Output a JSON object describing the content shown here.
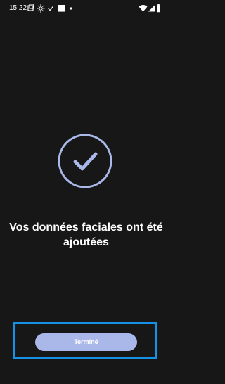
{
  "status_bar": {
    "time": "15:22",
    "icons": [
      "screenshot-icon",
      "brightness-icon",
      "check-small-icon",
      "image-icon",
      "dot-icon",
      "wifi-icon",
      "signal-icon",
      "battery-icon"
    ]
  },
  "main": {
    "success_icon": "check-circle-icon",
    "message_line1": "Vos données faciales ont été",
    "message_line2": "ajoutées"
  },
  "footer": {
    "done_label": "Terminé"
  },
  "colors": {
    "background": "#171717",
    "accent": "#a9b8e8",
    "focus_frame": "#1592e6"
  }
}
